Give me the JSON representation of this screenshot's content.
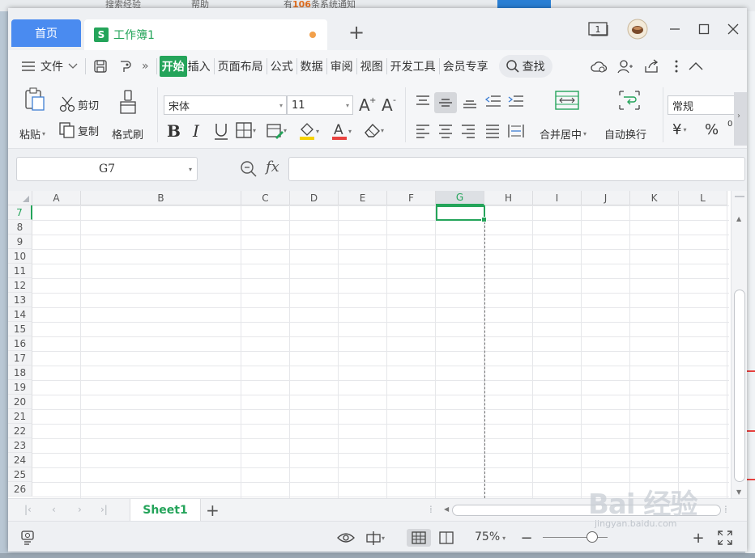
{
  "background": {
    "top_left_text": "搜索经验",
    "top_mid_text": "帮助",
    "notice_prefix": "有",
    "notice_count": "106",
    "notice_suffix": "条系统通知"
  },
  "titlebar": {
    "home_tab": "首页",
    "doc_tab": "工作簿1",
    "doc_icon_letter": "S",
    "add_tab": "+",
    "window_count": "1"
  },
  "menubar": {
    "file_label": "文件",
    "more": "»",
    "tabs": [
      "开始",
      "插入",
      "页面布局",
      "公式",
      "数据",
      "审阅",
      "视图",
      "开发工具",
      "会员专享"
    ],
    "active_tab": "开始",
    "search_label": "查找"
  },
  "ribbon": {
    "paste": "粘贴",
    "cut": "剪切",
    "copy": "复制",
    "format_painter": "格式刷",
    "font_name": "宋体",
    "font_size": "11",
    "merge_center": "合并居中",
    "wrap_text": "自动换行",
    "number_format": "常规",
    "currency": "¥",
    "percent": "%",
    "more_digit": "0"
  },
  "formula_bar": {
    "name_box": "G7",
    "fx": "fx",
    "formula": ""
  },
  "grid": {
    "columns": [
      "A",
      "B",
      "C",
      "D",
      "E",
      "F",
      "G",
      "H",
      "I",
      "J",
      "K",
      "L"
    ],
    "rows": [
      "7",
      "8",
      "9",
      "10",
      "11",
      "12",
      "13",
      "14",
      "15",
      "16",
      "17",
      "18",
      "19",
      "20",
      "21",
      "22",
      "23",
      "24",
      "25",
      "26"
    ],
    "selected_column": "G",
    "selected_row": "7"
  },
  "sheets": {
    "tabs": [
      "Sheet1"
    ],
    "add": "+"
  },
  "statusbar": {
    "zoom": "75%",
    "zoom_out": "−",
    "zoom_in": "+"
  },
  "watermark": {
    "brand": "Bai 经验",
    "url": "jingyan.baidu.com"
  },
  "colors": {
    "accent_green": "#24a45a",
    "home_tab_blue": "#4a8bf0",
    "unsaved_dot": "#f2a04a"
  }
}
